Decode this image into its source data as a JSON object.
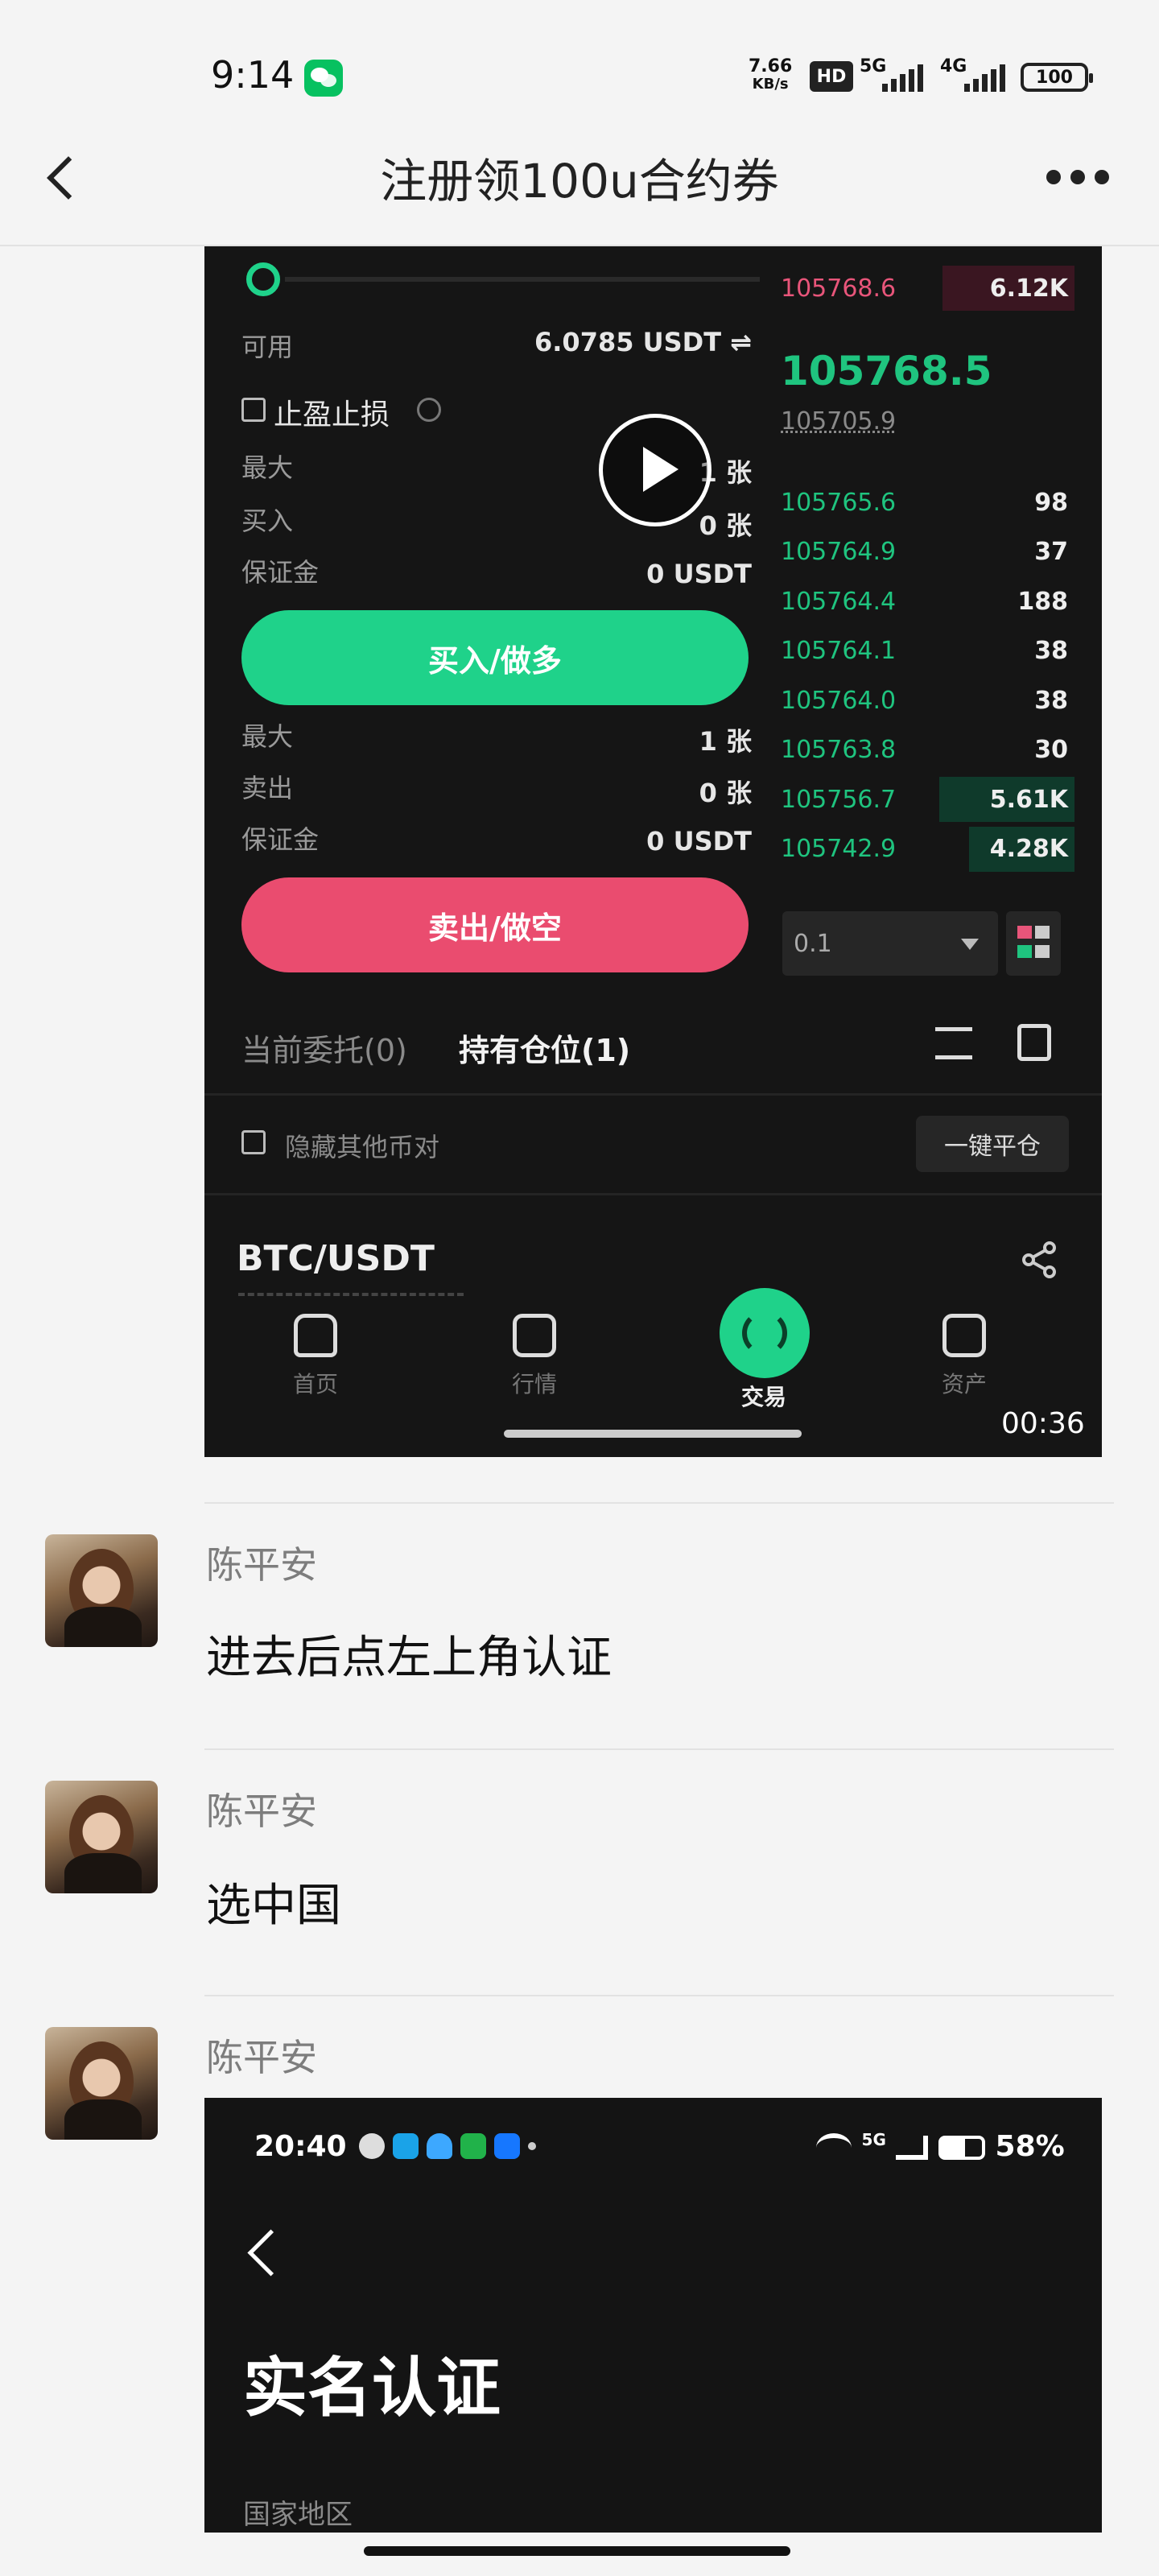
{
  "status_bar": {
    "time": "9:14",
    "net_speed_value": "7.66",
    "net_speed_unit": "KB/s",
    "hd_label": "HD",
    "net1": "5G",
    "net2": "4G",
    "battery": "100"
  },
  "header": {
    "title": "注册领100u合约券"
  },
  "video_card": {
    "available_label": "可用",
    "available_value": "6.0785 USDT ⇌",
    "tp_sl_label": "止盈止损",
    "buy_section": {
      "max_label": "最大",
      "max_value": "1 张",
      "buy_label": "买入",
      "buy_value": "0 张",
      "margin_label": "保证金",
      "margin_value": "0 USDT"
    },
    "buy_button": "买入/做多",
    "sell_section": {
      "max_label": "最大",
      "max_value": "1 张",
      "sell_label": "卖出",
      "sell_value": "0 张",
      "margin_label": "保证金",
      "margin_value": "0 USDT"
    },
    "sell_button": "卖出/做空",
    "orderbook": {
      "ask": [
        {
          "price": "105768.6",
          "qty": "6.12K",
          "depth": 0.45
        }
      ],
      "last_price": "105768.5",
      "mark_price": "105705.9",
      "bids": [
        {
          "price": "105765.6",
          "qty": "98",
          "depth": 0
        },
        {
          "price": "105764.9",
          "qty": "37",
          "depth": 0
        },
        {
          "price": "105764.4",
          "qty": "188",
          "depth": 0
        },
        {
          "price": "105764.1",
          "qty": "38",
          "depth": 0
        },
        {
          "price": "105764.0",
          "qty": "38",
          "depth": 0
        },
        {
          "price": "105763.8",
          "qty": "30",
          "depth": 0
        },
        {
          "price": "105756.7",
          "qty": "5.61K",
          "depth": 0.46
        },
        {
          "price": "105742.9",
          "qty": "4.28K",
          "depth": 0.36
        }
      ],
      "step_value": "0.1"
    },
    "tabs": [
      {
        "label": "当前委托(0)",
        "active": false
      },
      {
        "label": "持有仓位(1)",
        "active": true
      }
    ],
    "hide_other_pairs": "隐藏其他币对",
    "close_all_button": "一键平仓",
    "pair": "BTC/USDT",
    "bottom_nav": [
      "首页",
      "行情",
      "交易",
      "资产"
    ],
    "duration": "00:36"
  },
  "messages": [
    {
      "sender": "陈平安",
      "text": "进去后点左上角认证"
    },
    {
      "sender": "陈平安",
      "text": "选中国"
    },
    {
      "sender": "陈平安",
      "text": ""
    }
  ],
  "image2": {
    "time": "20:40",
    "net": "5G",
    "battery": "58%",
    "title": "实名认证",
    "field_label": "国家地区"
  },
  "colors": {
    "buy_green": "#1fd28a",
    "sell_red": "#ea4c6f",
    "wechat_green": "#07c160"
  }
}
